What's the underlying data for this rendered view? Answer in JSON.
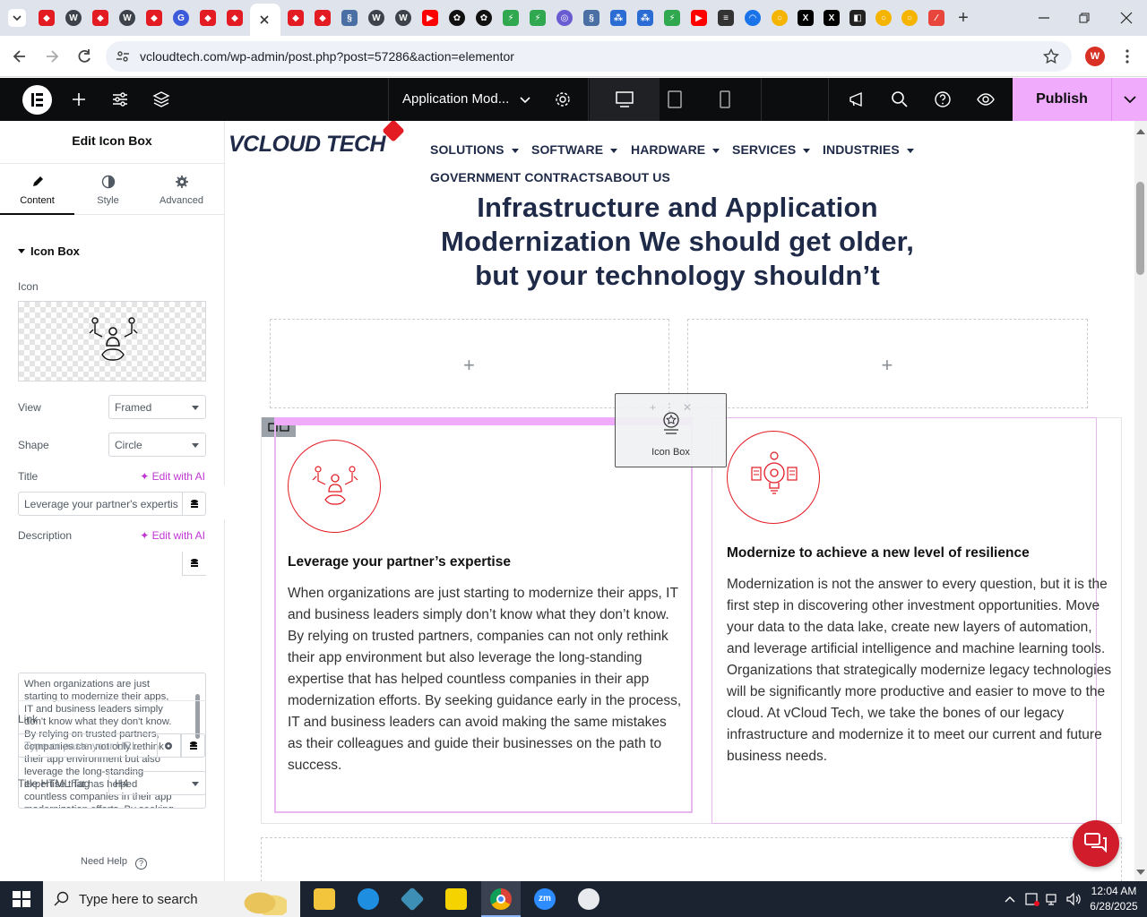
{
  "browser": {
    "url": "vcloudtech.com/wp-admin/post.php?post=57286&action=elementor",
    "profile_initial": "W",
    "new_tab_label": "+"
  },
  "editor": {
    "doc_title": "Application Mod...",
    "publish_label": "Publish"
  },
  "panel": {
    "title": "Edit Icon Box",
    "tabs": [
      {
        "label": "Content",
        "icon": "pencil-icon"
      },
      {
        "label": "Style",
        "icon": "half-circle-icon"
      },
      {
        "label": "Advanced",
        "icon": "gear-icon"
      }
    ],
    "section_title": "Icon Box",
    "icon_label": "Icon",
    "view_label": "View",
    "view_value": "Framed",
    "shape_label": "Shape",
    "shape_value": "Circle",
    "title_label": "Title",
    "edit_ai_label": "Edit with AI",
    "title_value": "Leverage your partner's expertis",
    "description_label": "Description",
    "description_value": "When organizations are just starting to modernize their apps, IT and business leaders simply don't know what they don't know. By relying on trusted partners, companies can not only rethink their app environment but also leverage the long-standing expertise that has helped countless companies in their app modernization efforts. By seeking",
    "link_label": "Link",
    "link_placeholder": "Type or paste your URL",
    "html_tag_label": "Title HTML Tag",
    "html_tag_value": "H4",
    "need_help_label": "Need Help"
  },
  "site": {
    "logo_text": "VCLOUD TECH",
    "nav": [
      "SOLUTIONS",
      "SOFTWARE",
      "HARDWARE",
      "SERVICES",
      "INDUSTRIES"
    ],
    "nav_row2": [
      "GOVERNMENT CONTRACTS",
      "ABOUT US"
    ],
    "heading": "Infrastructure and Application Modernization We should get older, but your technology shouldn’t",
    "add_label": "+",
    "drag_widget_label": "Icon Box",
    "box1": {
      "title": "Leverage your partner’s expertise",
      "text": "When organizations are just starting to modernize their apps, IT and business leaders simply don’t know what they don’t know. By relying on trusted partners, companies can not only rethink their app environment but also leverage the long-standing expertise that has helped countless companies in their app modernization efforts. By seeking guidance early in the process, IT and business leaders can avoid making the same mistakes as their colleagues and guide their businesses on the path to success."
    },
    "box2": {
      "title": "Modernize to achieve a new level of resilience",
      "text": "Modernization is not the answer to every question, but it is the first step in discovering other investment opportunities. Move your data to the data lake, create new layers of automation, and leverage artificial intelligence and machine learning tools. Organizations that strategically modernize legacy technologies will be significantly more productive and easier to move to the cloud. At vCloud Tech, we take the bones of our legacy infrastructure and modernize it to meet our current and future business needs."
    }
  },
  "taskbar": {
    "search_placeholder": "Type here to search",
    "time": "12:04 AM",
    "date": "6/28/2025"
  },
  "colors": {
    "accent_pink": "#f0abfc",
    "brand_red": "#e31b23",
    "heading_navy": "#1e2a47"
  }
}
